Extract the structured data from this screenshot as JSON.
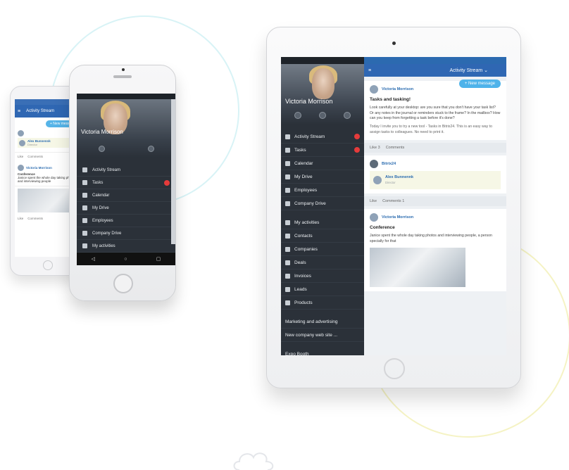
{
  "user": {
    "name": "Victoria Morrison"
  },
  "activity_stream": {
    "title": "Activity Stream",
    "title_with_chevron": "Activity Stream ⌄",
    "new_message": "+ New message"
  },
  "phone_menu": [
    {
      "label": "Activity Stream",
      "badge": false
    },
    {
      "label": "Tasks",
      "badge": true
    },
    {
      "label": "Calendar",
      "badge": false
    },
    {
      "label": "My Drive",
      "badge": false
    },
    {
      "label": "Employees",
      "badge": false
    },
    {
      "label": "Company Drive",
      "badge": false
    },
    {
      "label": "My activities",
      "badge": false
    }
  ],
  "tablet_menu": {
    "main": [
      {
        "label": "Activity Stream",
        "badge": true
      },
      {
        "label": "Tasks",
        "badge": true
      },
      {
        "label": "Calendar",
        "badge": false
      },
      {
        "label": "My Drive",
        "badge": false
      },
      {
        "label": "Employees",
        "badge": false
      },
      {
        "label": "Company Drive",
        "badge": false
      }
    ],
    "crm": [
      {
        "label": "My activities"
      },
      {
        "label": "Contacts"
      },
      {
        "label": "Companies"
      },
      {
        "label": "Deals"
      },
      {
        "label": "Invoices"
      },
      {
        "label": "Leads"
      },
      {
        "label": "Products"
      }
    ],
    "groups": [
      {
        "label": "Marketing and advertising"
      },
      {
        "label": "New company web site ..."
      }
    ],
    "extranet": [
      {
        "label": "Expo Booth"
      }
    ]
  },
  "posts": {
    "tasks": {
      "author": "Victoria Morrison",
      "title": "Tasks and tasking!",
      "text": "Look carefully at your desktop: are you sure that you don't have your task list? Or any notes in the journal or reminders stuck to the frame? In the mailbox? How can you keep from forgetting a task before it's done?",
      "text2": "Today I invite you to try a new tool - Tasks in Bitrix24. This is an easy way to assign tasks to colleagues. No need to print it.",
      "like": "Like",
      "like_count": "3",
      "comments": "Comments"
    },
    "bitrix": {
      "author": "Bitrix24",
      "quote_name": "Alex Bunnennk",
      "quote_role": "Director",
      "like": "Like",
      "comments": "Comments",
      "comments_count": "1"
    },
    "conference": {
      "author": "Victoria Morrison",
      "title": "Conference",
      "text": "Janice spent the whole day taking photos and interviewing people, a person specially for that",
      "like": "Like",
      "comments": "Comments"
    }
  },
  "back_phone": {
    "title": "Activity Stream",
    "new_message": "+ New message",
    "quote_name": "Alex Bunnennk",
    "quote_role": "Director",
    "like": "Like",
    "comments": "Comments",
    "author": "Victoria Morrison",
    "conf_title": "Conference",
    "conf_text": "Janice spent the whole day taking photos and interviewing people",
    "comments2": "Comments"
  },
  "colors": {
    "sidebar": "#2b3139",
    "header": "#2f67b3",
    "badge": "#e53b3b",
    "pill": "#4fb3ea"
  }
}
